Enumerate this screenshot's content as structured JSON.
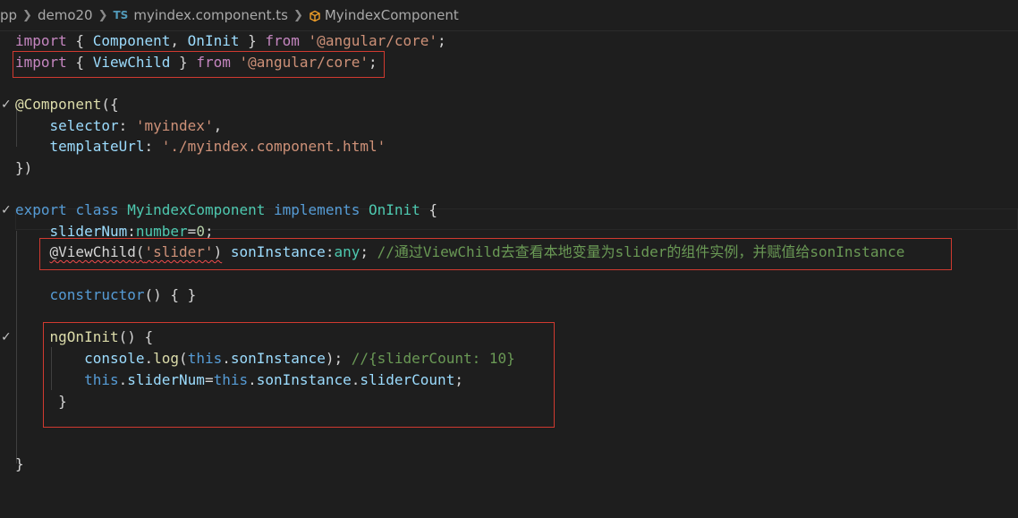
{
  "breadcrumb": {
    "segment_app": "pp",
    "segment_folder": "demo20",
    "ts_badge": "TS",
    "segment_file": "myindex.component.ts",
    "segment_symbol": "MyindexComponent"
  },
  "tokens": {
    "import": "import",
    "from": "from",
    "export": "export",
    "class": "class",
    "implements": "implements",
    "this": "this",
    "any": "any",
    "number": "number",
    "Component": "Component",
    "OnInit": "OnInit",
    "ViewChild": "ViewChild",
    "angular_core": "'@angular/core'",
    "decorator_component": "@Component",
    "selector": "selector",
    "selector_value": "'myindex'",
    "templateUrl": "templateUrl",
    "templateUrl_value": "'./myindex.component.html'",
    "MyindexComponent": "MyindexComponent",
    "sliderNum": "sliderNum",
    "zero": "0",
    "decorator_viewchild": "@ViewChild",
    "slider_ref": "'slider'",
    "sonInstance": "sonInstance",
    "comment_viewchild": "//通过ViewChild去查看本地变量为slider的组件实例，并赋值给sonInstance",
    "constructor": "constructor",
    "ngOnInit": "ngOnInit",
    "console": "console",
    "log": "log",
    "comment_log": "//{sliderCount: 10}",
    "sliderCount": "sliderCount"
  },
  "colors": {
    "editor_bg": "#1e1e1e",
    "keyword": "#569cd6",
    "control_keyword": "#c586c0",
    "string": "#ce9178",
    "variable": "#9cdcfe",
    "function": "#dcdcaa",
    "type": "#4ec9b0",
    "number": "#b5cea8",
    "comment": "#6a9955",
    "annotation_box": "#d03a30"
  },
  "icons": {
    "ts_file": "typescript-file-icon",
    "symbol": "class-symbol-icon",
    "fold": "fold-check-icon"
  }
}
